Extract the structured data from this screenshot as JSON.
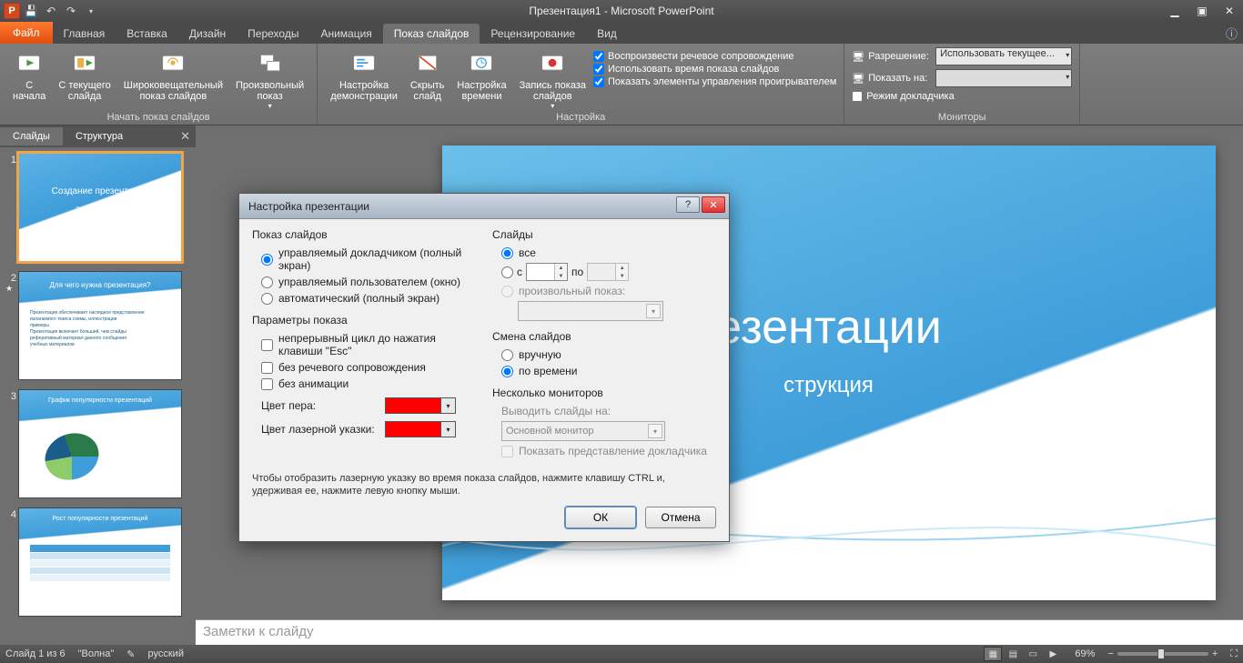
{
  "titlebar": {
    "app_logo_text": "P",
    "title": "Презентация1 - Microsoft PowerPoint"
  },
  "tabs": {
    "file": "Файл",
    "items": [
      "Главная",
      "Вставка",
      "Дизайн",
      "Переходы",
      "Анимация",
      "Показ слайдов",
      "Рецензирование",
      "Вид"
    ],
    "active_index": 5
  },
  "ribbon": {
    "group_start": {
      "label": "Начать показ слайдов",
      "from_start": "С\nначала",
      "from_current": "С текущего\nслайда",
      "broadcast": "Широковещательный\nпоказ слайдов",
      "custom": "Произвольный\nпоказ"
    },
    "group_setup": {
      "label": "Настройка",
      "setup": "Настройка\nдемонстрации",
      "hide": "Скрыть\nслайд",
      "timing": "Настройка\nвремени",
      "record": "Запись показа\nслайдов",
      "cb_narration": "Воспроизвести речевое сопровождение",
      "cb_timings": "Использовать время показа слайдов",
      "cb_controls": "Показать элементы управления проигрывателем"
    },
    "group_mon": {
      "label": "Мониторы",
      "res_label": "Разрешение:",
      "res_value": "Использовать текущее...",
      "show_on": "Показать на:",
      "presenter": "Режим докладчика"
    }
  },
  "sidepanel": {
    "tab_slides": "Слайды",
    "tab_outline": "Структура",
    "thumbs": [
      {
        "n": "1",
        "title_top": "Создание презентации",
        "sub": "Подробная инструкция",
        "type": "title"
      },
      {
        "n": "2",
        "title_top": "Для чего нужна презентация?",
        "type": "content"
      },
      {
        "n": "3",
        "title_top": "График популярности презентаций",
        "type": "chart"
      },
      {
        "n": "4",
        "title_top": "Рост популярности презентаций",
        "type": "table"
      }
    ]
  },
  "slide": {
    "title": "езентации",
    "subtitle": "струкция"
  },
  "notes": {
    "placeholder": "Заметки к слайду"
  },
  "dialog": {
    "title": "Настройка презентации",
    "sec_show": {
      "title": "Показ слайдов",
      "r1": "управляемый докладчиком (полный экран)",
      "r2": "управляемый пользователем (окно)",
      "r3": "автоматический (полный экран)"
    },
    "sec_slides": {
      "title": "Слайды",
      "r_all": "все",
      "r_from": "с",
      "to_label": "по",
      "r_custom": "произвольный показ:"
    },
    "sec_params": {
      "title": "Параметры показа",
      "c1": "непрерывный цикл до нажатия клавиши \"Esc\"",
      "c2": "без речевого сопровождения",
      "c3": "без анимации",
      "pen": "Цвет пера:",
      "laser": "Цвет лазерной указки:"
    },
    "sec_advance": {
      "title": "Смена слайдов",
      "r1": "вручную",
      "r2": "по времени"
    },
    "sec_multi": {
      "title": "Несколько мониторов",
      "out_label": "Выводить слайды на:",
      "out_value": "Основной монитор",
      "presenter": "Показать представление докладчика"
    },
    "hint": "Чтобы отобразить лазерную указку во время показа слайдов, нажмите клавишу CTRL и, удерживая ее, нажмите левую кнопку мыши.",
    "ok": "ОК",
    "cancel": "Отмена"
  },
  "status": {
    "slide": "Слайд 1 из 6",
    "theme": "\"Волна\"",
    "lang": "русский",
    "zoom": "69%"
  },
  "colors": {
    "pen": "#ff0000",
    "laser": "#ff0000"
  }
}
